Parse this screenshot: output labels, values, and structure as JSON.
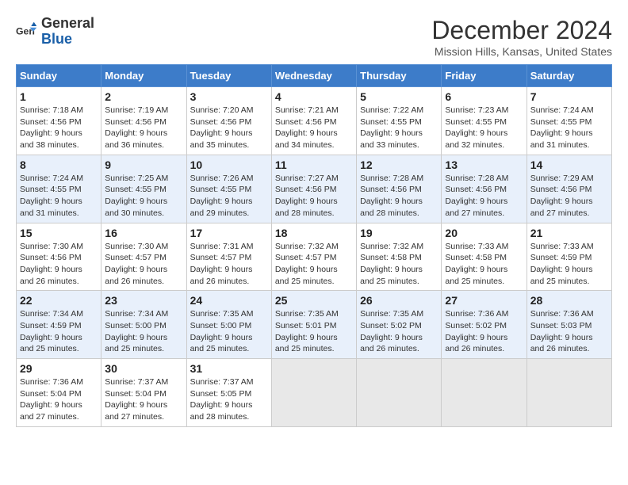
{
  "logo": {
    "text_general": "General",
    "text_blue": "Blue"
  },
  "title": "December 2024",
  "location": "Mission Hills, Kansas, United States",
  "days_of_week": [
    "Sunday",
    "Monday",
    "Tuesday",
    "Wednesday",
    "Thursday",
    "Friday",
    "Saturday"
  ],
  "weeks": [
    [
      {
        "day": "1",
        "sunrise": "7:18 AM",
        "sunset": "4:56 PM",
        "daylight": "9 hours and 38 minutes."
      },
      {
        "day": "2",
        "sunrise": "7:19 AM",
        "sunset": "4:56 PM",
        "daylight": "9 hours and 36 minutes."
      },
      {
        "day": "3",
        "sunrise": "7:20 AM",
        "sunset": "4:56 PM",
        "daylight": "9 hours and 35 minutes."
      },
      {
        "day": "4",
        "sunrise": "7:21 AM",
        "sunset": "4:56 PM",
        "daylight": "9 hours and 34 minutes."
      },
      {
        "day": "5",
        "sunrise": "7:22 AM",
        "sunset": "4:55 PM",
        "daylight": "9 hours and 33 minutes."
      },
      {
        "day": "6",
        "sunrise": "7:23 AM",
        "sunset": "4:55 PM",
        "daylight": "9 hours and 32 minutes."
      },
      {
        "day": "7",
        "sunrise": "7:24 AM",
        "sunset": "4:55 PM",
        "daylight": "9 hours and 31 minutes."
      }
    ],
    [
      {
        "day": "8",
        "sunrise": "7:24 AM",
        "sunset": "4:55 PM",
        "daylight": "9 hours and 31 minutes."
      },
      {
        "day": "9",
        "sunrise": "7:25 AM",
        "sunset": "4:55 PM",
        "daylight": "9 hours and 30 minutes."
      },
      {
        "day": "10",
        "sunrise": "7:26 AM",
        "sunset": "4:55 PM",
        "daylight": "9 hours and 29 minutes."
      },
      {
        "day": "11",
        "sunrise": "7:27 AM",
        "sunset": "4:56 PM",
        "daylight": "9 hours and 28 minutes."
      },
      {
        "day": "12",
        "sunrise": "7:28 AM",
        "sunset": "4:56 PM",
        "daylight": "9 hours and 28 minutes."
      },
      {
        "day": "13",
        "sunrise": "7:28 AM",
        "sunset": "4:56 PM",
        "daylight": "9 hours and 27 minutes."
      },
      {
        "day": "14",
        "sunrise": "7:29 AM",
        "sunset": "4:56 PM",
        "daylight": "9 hours and 27 minutes."
      }
    ],
    [
      {
        "day": "15",
        "sunrise": "7:30 AM",
        "sunset": "4:56 PM",
        "daylight": "9 hours and 26 minutes."
      },
      {
        "day": "16",
        "sunrise": "7:30 AM",
        "sunset": "4:57 PM",
        "daylight": "9 hours and 26 minutes."
      },
      {
        "day": "17",
        "sunrise": "7:31 AM",
        "sunset": "4:57 PM",
        "daylight": "9 hours and 26 minutes."
      },
      {
        "day": "18",
        "sunrise": "7:32 AM",
        "sunset": "4:57 PM",
        "daylight": "9 hours and 25 minutes."
      },
      {
        "day": "19",
        "sunrise": "7:32 AM",
        "sunset": "4:58 PM",
        "daylight": "9 hours and 25 minutes."
      },
      {
        "day": "20",
        "sunrise": "7:33 AM",
        "sunset": "4:58 PM",
        "daylight": "9 hours and 25 minutes."
      },
      {
        "day": "21",
        "sunrise": "7:33 AM",
        "sunset": "4:59 PM",
        "daylight": "9 hours and 25 minutes."
      }
    ],
    [
      {
        "day": "22",
        "sunrise": "7:34 AM",
        "sunset": "4:59 PM",
        "daylight": "9 hours and 25 minutes."
      },
      {
        "day": "23",
        "sunrise": "7:34 AM",
        "sunset": "5:00 PM",
        "daylight": "9 hours and 25 minutes."
      },
      {
        "day": "24",
        "sunrise": "7:35 AM",
        "sunset": "5:00 PM",
        "daylight": "9 hours and 25 minutes."
      },
      {
        "day": "25",
        "sunrise": "7:35 AM",
        "sunset": "5:01 PM",
        "daylight": "9 hours and 25 minutes."
      },
      {
        "day": "26",
        "sunrise": "7:35 AM",
        "sunset": "5:02 PM",
        "daylight": "9 hours and 26 minutes."
      },
      {
        "day": "27",
        "sunrise": "7:36 AM",
        "sunset": "5:02 PM",
        "daylight": "9 hours and 26 minutes."
      },
      {
        "day": "28",
        "sunrise": "7:36 AM",
        "sunset": "5:03 PM",
        "daylight": "9 hours and 26 minutes."
      }
    ],
    [
      {
        "day": "29",
        "sunrise": "7:36 AM",
        "sunset": "5:04 PM",
        "daylight": "9 hours and 27 minutes."
      },
      {
        "day": "30",
        "sunrise": "7:37 AM",
        "sunset": "5:04 PM",
        "daylight": "9 hours and 27 minutes."
      },
      {
        "day": "31",
        "sunrise": "7:37 AM",
        "sunset": "5:05 PM",
        "daylight": "9 hours and 28 minutes."
      },
      null,
      null,
      null,
      null
    ]
  ],
  "labels": {
    "sunrise": "Sunrise:",
    "sunset": "Sunset:",
    "daylight": "Daylight hours"
  }
}
